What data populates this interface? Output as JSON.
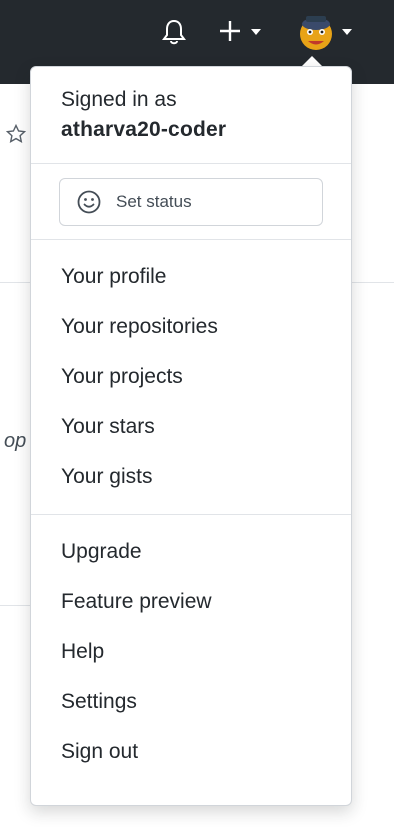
{
  "topbar": {
    "icons": [
      "bell-icon",
      "plus-icon",
      "dropdown-caret-icon",
      "avatar",
      "dropdown-caret-icon"
    ],
    "background_color": "#24292e"
  },
  "dropdown": {
    "signed_in_label": "Signed in as",
    "username": "atharva20-coder",
    "set_status_label": "Set status",
    "group1": [
      "Your profile",
      "Your repositories",
      "Your projects",
      "Your stars",
      "Your gists"
    ],
    "group2": [
      "Upgrade",
      "Feature preview",
      "Help",
      "Settings",
      "Sign out"
    ]
  },
  "background": {
    "fragment_text": "op"
  },
  "colors": {
    "border": "#d1d5da",
    "text": "#24292e",
    "muted": "#444d56"
  }
}
